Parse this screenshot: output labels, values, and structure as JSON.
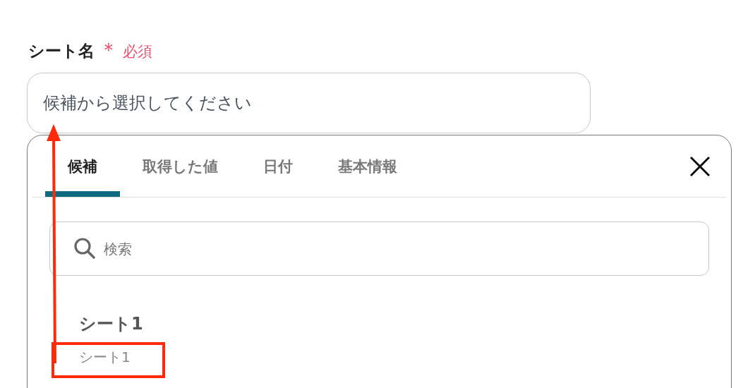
{
  "field": {
    "label": "シート名",
    "required_mark": "＊",
    "required_text": "必須",
    "placeholder": "候補から選択してください"
  },
  "panel": {
    "tabs": [
      {
        "label": "候補",
        "selected": true
      },
      {
        "label": "取得した値",
        "selected": false
      },
      {
        "label": "日付",
        "selected": false
      },
      {
        "label": "基本情報",
        "selected": false
      }
    ],
    "search": {
      "placeholder": "検索"
    },
    "options": [
      {
        "title": "シート1",
        "subtitle": "シート1"
      }
    ]
  }
}
